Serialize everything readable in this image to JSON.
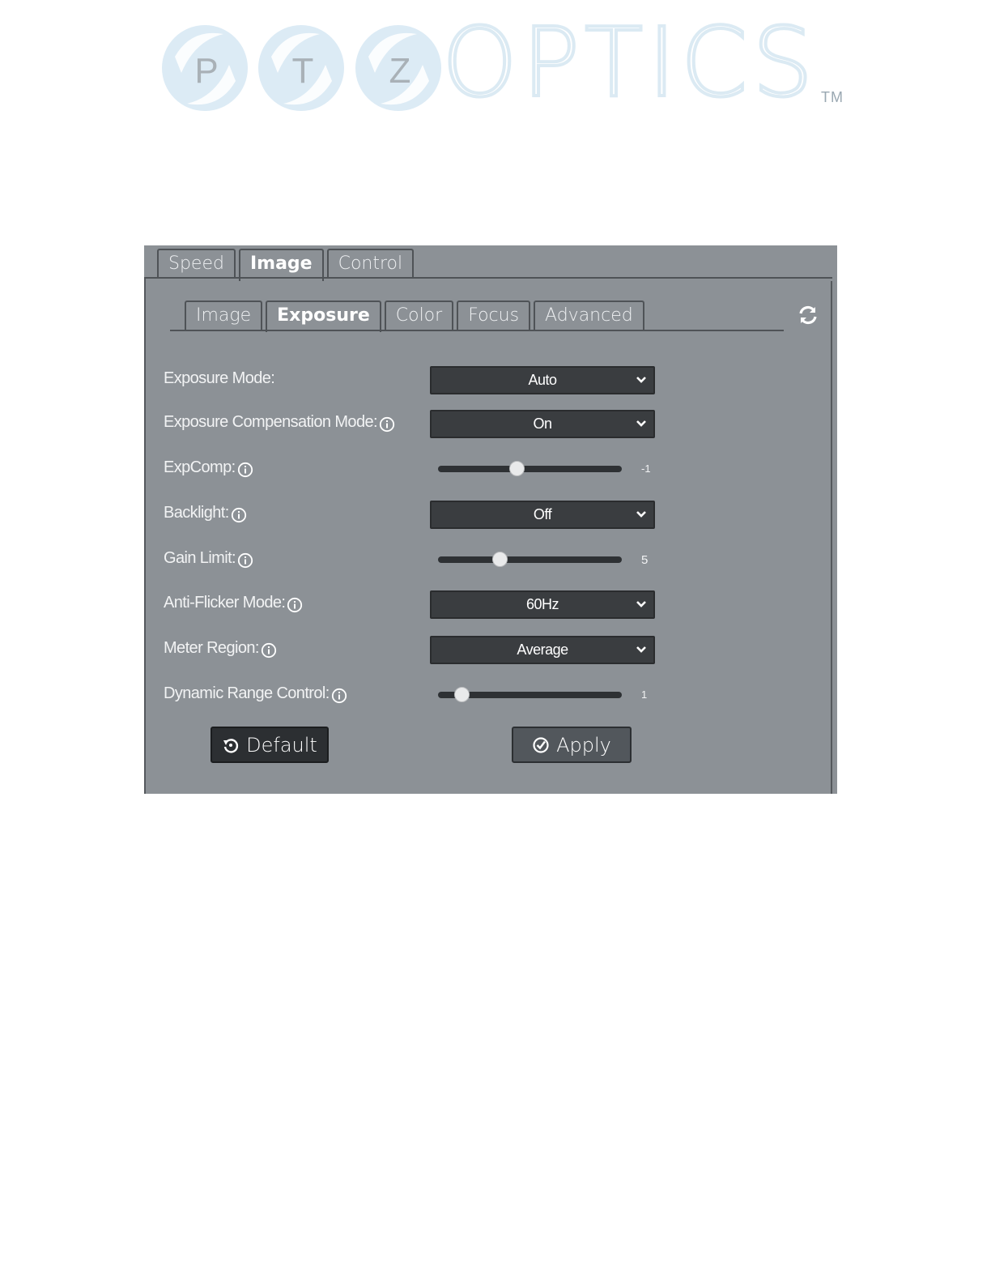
{
  "logo": {
    "letters": [
      "P",
      "T",
      "Z"
    ],
    "word": "OPTICS",
    "tm": "TM"
  },
  "tabs": {
    "top": [
      {
        "label": "Speed",
        "active": false
      },
      {
        "label": "Image",
        "active": true
      },
      {
        "label": "Control",
        "active": false
      }
    ],
    "sub": [
      {
        "label": "Image",
        "active": false
      },
      {
        "label": "Exposure",
        "active": true
      },
      {
        "label": "Color",
        "active": false
      },
      {
        "label": "Focus",
        "active": false
      },
      {
        "label": "Advanced",
        "active": false
      }
    ]
  },
  "refresh_icon": "refresh-icon",
  "settings": {
    "exposure_mode": {
      "label": "Exposure Mode:",
      "value": "Auto"
    },
    "exposure_comp_mode": {
      "label": "Exposure Compensation Mode:",
      "value": "On"
    },
    "expcomp": {
      "label": "ExpComp:",
      "value": "-1",
      "fraction": 0.43
    },
    "backlight": {
      "label": "Backlight:",
      "value": "Off"
    },
    "gain_limit": {
      "label": "Gain Limit:",
      "value": "5",
      "fraction": 0.34
    },
    "anti_flicker": {
      "label": "Anti-Flicker Mode:",
      "value": "60Hz"
    },
    "meter_region": {
      "label": "Meter Region:",
      "value": "Average"
    },
    "drc": {
      "label": "Dynamic Range Control:",
      "value": "1",
      "fraction": 0.13
    }
  },
  "buttons": {
    "default_label": "Default",
    "apply_label": "Apply"
  },
  "colors": {
    "panel_bg": "#8c9196",
    "logo_blue": "#dbeaf3"
  }
}
